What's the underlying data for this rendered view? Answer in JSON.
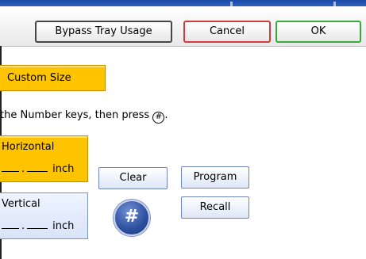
{
  "toolbar": {
    "bypass_label": "Bypass Tray Usage",
    "cancel_label": "Cancel",
    "ok_label": "OK"
  },
  "paper_size": {
    "custom_size_label": "Custom Size"
  },
  "instruction": {
    "text": "the Number keys, then press",
    "symbol": "#",
    "end": "."
  },
  "horizontal": {
    "label": "Horizontal",
    "separator": ".",
    "unit": "inch"
  },
  "vertical": {
    "label": "Vertical",
    "separator": ".",
    "unit": "inch"
  },
  "buttons": {
    "clear_label": "Clear",
    "program_label": "Program",
    "recall_label": "Recall",
    "hash_label": "#"
  },
  "colors": {
    "selected": "#ffc400",
    "header_blue": "#1a4aa8",
    "cancel_border": "#d53a3a",
    "ok_border": "#3aa83a"
  }
}
